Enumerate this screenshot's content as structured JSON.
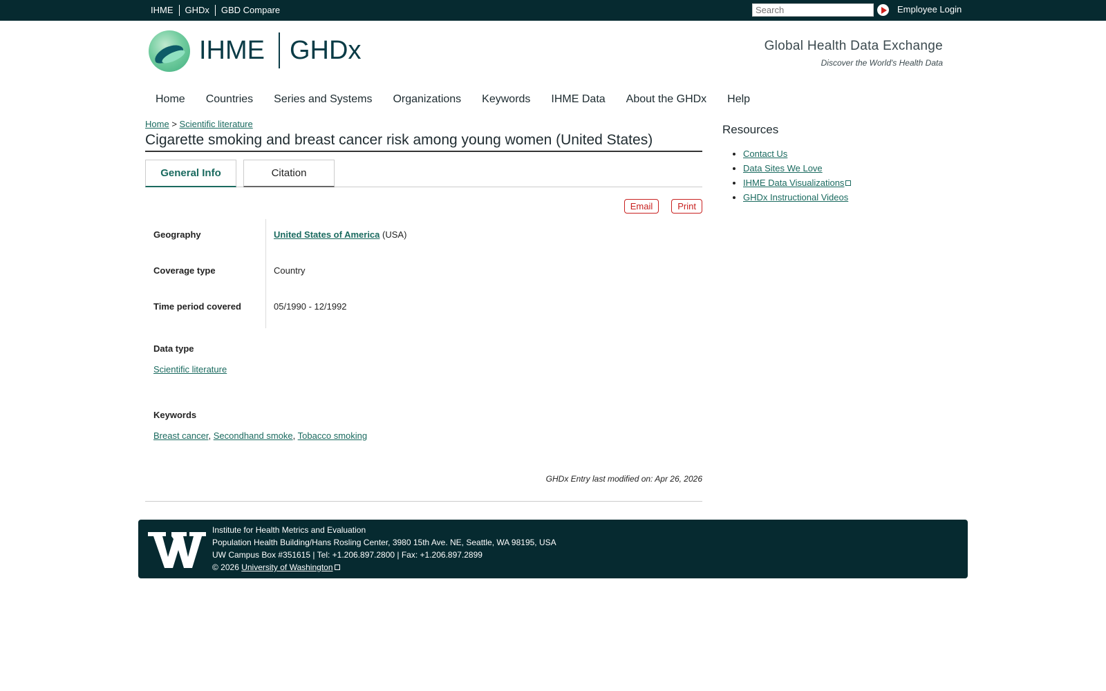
{
  "topbar": {
    "links": [
      "IHME",
      "GHDx",
      "GBD Compare"
    ],
    "search_placeholder": "Search",
    "login": "Employee Login"
  },
  "header": {
    "brand_left": "IHME",
    "brand_right": "GHDx",
    "tagline_title": "Global Health Data Exchange",
    "tagline_sub": "Discover the World's Health Data"
  },
  "nav": [
    "Home",
    "Countries",
    "Series and Systems",
    "Organizations",
    "Keywords",
    "IHME Data",
    "About the GHDx",
    "Help"
  ],
  "breadcrumb": {
    "home": "Home",
    "sep": ">",
    "current": "Scientific literature"
  },
  "page_title": "Cigarette smoking and breast cancer risk among young women (United States)",
  "tabs": [
    "General Info",
    "Citation"
  ],
  "actions": {
    "email": "Email",
    "print": "Print"
  },
  "info": {
    "geography_label": "Geography",
    "geography_link": "United States of America",
    "geography_code": "(USA)",
    "coverage_label": "Coverage type",
    "coverage_value": "Country",
    "time_label": "Time period covered",
    "time_value": "05/1990 - 12/1992"
  },
  "data_type": {
    "label": "Data type",
    "value": "Scientific literature"
  },
  "keywords": {
    "label": "Keywords",
    "items": [
      "Breast cancer",
      "Secondhand smoke",
      "Tobacco smoking"
    ]
  },
  "modified": "GHDx Entry last modified on: Apr 26, 2026",
  "sidebar": {
    "title": "Resources",
    "items": [
      "Contact Us",
      "Data Sites We Love",
      "IHME Data Visualizations",
      "GHDx Instructional Videos"
    ]
  },
  "footer": {
    "line1": "Institute for Health Metrics and Evaluation",
    "line2": "Population Health Building/Hans Rosling Center, 3980 15th Ave. NE, Seattle, WA 98195, USA",
    "line3": "UW Campus Box #351615 | Tel: +1.206.897.2800 | Fax: +1.206.897.2899",
    "copyright": "© 2026",
    "uw_link": "University of Washington"
  },
  "colors": {
    "topbar_bg": "#062a30",
    "link": "#1a6a5f",
    "action_red": "#c8201f"
  }
}
